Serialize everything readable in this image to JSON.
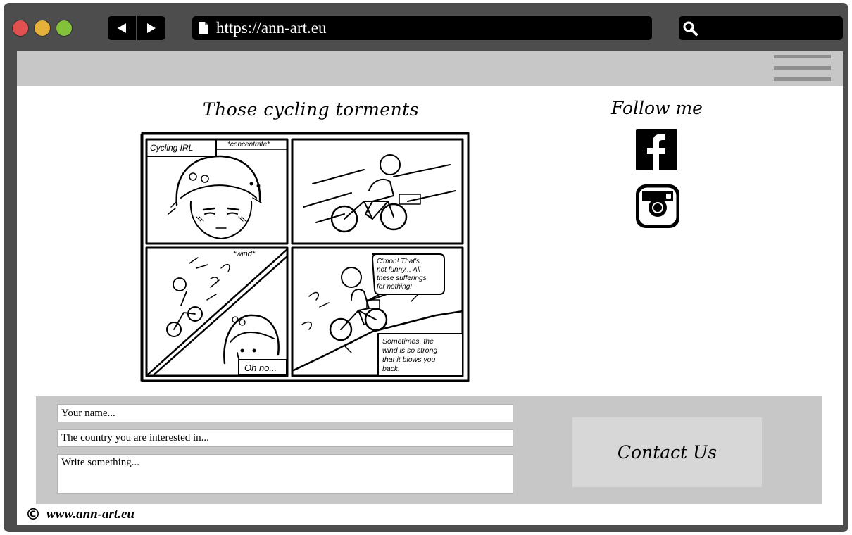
{
  "browser": {
    "url": "https://ann-art.eu",
    "traffic_lights": [
      "#e0514f",
      "#e6b13a",
      "#84c13b"
    ],
    "back_icon": "triangle-left-icon",
    "forward_icon": "triangle-right-icon",
    "page_icon": "document-icon",
    "search_icon": "magnifier-icon"
  },
  "topbar": {
    "menu_icon": "hamburger-icon"
  },
  "comic": {
    "title": "Those cycling torments",
    "panels": {
      "p1_caption": "Cycling IRL",
      "p1_sound": "*concentrate*",
      "p3_sound": "*wind*",
      "p3_caption": "Oh no...",
      "p4_speech": [
        "C'mon! That's",
        "not funny... All",
        "these sufferings",
        "for nothing!"
      ],
      "p4_caption": [
        "Sometimes, the",
        "wind is so strong",
        "that it blows you",
        "back."
      ]
    }
  },
  "social": {
    "title": "Follow me",
    "links": [
      {
        "icon": "facebook-icon",
        "label": "Facebook"
      },
      {
        "icon": "instagram-icon",
        "label": "Instagram"
      }
    ]
  },
  "contact": {
    "name_placeholder": "Your name...",
    "country_placeholder": "The country you are interested in...",
    "message_placeholder": "Write something...",
    "button_label": "Contact Us"
  },
  "footer": {
    "copyright_symbol": "©",
    "site": "www.ann-art.eu"
  }
}
